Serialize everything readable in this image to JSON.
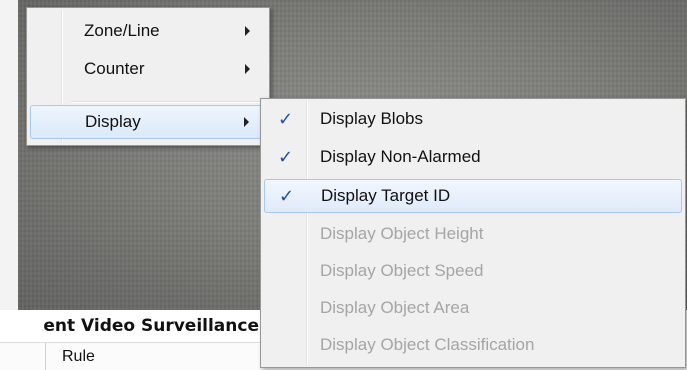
{
  "video": {
    "description_hidden": ""
  },
  "app": {
    "title_fragment": "ent Video Surveillance"
  },
  "table": {
    "header": {
      "col_rule": "Rule"
    }
  },
  "context_menu": {
    "items": [
      {
        "label": "Zone/Line",
        "has_submenu": true
      },
      {
        "label": "Counter",
        "has_submenu": true
      },
      {
        "label": "Display",
        "has_submenu": true,
        "active": true
      }
    ]
  },
  "display_submenu": {
    "check_glyph": "✓",
    "items": [
      {
        "label": "Display Blobs",
        "checked": true,
        "enabled": true
      },
      {
        "label": "Display Non-Alarmed",
        "checked": true,
        "enabled": true
      },
      {
        "label": "Display Target ID",
        "checked": true,
        "enabled": true,
        "hovered": true
      },
      {
        "label": "Display Object Height",
        "checked": false,
        "enabled": false
      },
      {
        "label": "Display Object Speed",
        "checked": false,
        "enabled": false
      },
      {
        "label": "Display Object Area",
        "checked": false,
        "enabled": false
      },
      {
        "label": "Display Object Classification",
        "checked": false,
        "enabled": false
      }
    ]
  },
  "colors": {
    "accent_check": "#1f4f9e",
    "disabled_text": "#a5a5a5",
    "highlight_border": "#a8c8ee"
  }
}
